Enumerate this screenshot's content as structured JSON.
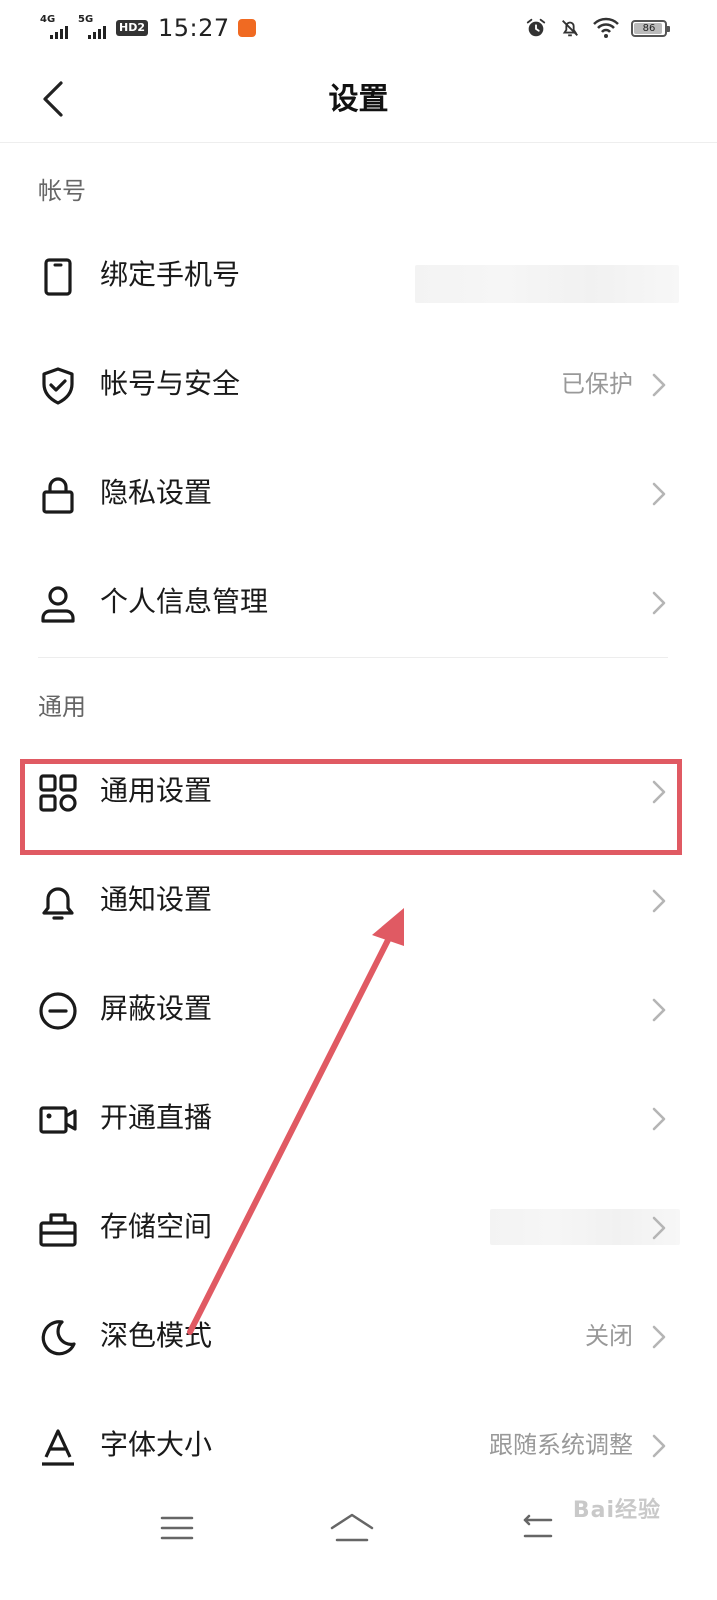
{
  "status_bar": {
    "net1": "4G",
    "net2": "5G",
    "hd": "HD2",
    "time": "15:27",
    "battery": "86",
    "battery_level": 0.86,
    "icons": [
      "alarm-icon",
      "mute-icon",
      "wifi-icon",
      "battery-icon"
    ]
  },
  "header": {
    "title": "设置",
    "back_icon": "chevron-left-icon"
  },
  "sections": {
    "account": {
      "title": "帐号",
      "items": [
        {
          "label": "绑定手机号",
          "value": "",
          "icon": "phone-icon",
          "chevron": false
        },
        {
          "label": "帐号与安全",
          "value": "已保护",
          "icon": "shield-check-icon",
          "chevron": true
        },
        {
          "label": "隐私设置",
          "value": "",
          "icon": "lock-icon",
          "chevron": true
        },
        {
          "label": "个人信息管理",
          "value": "",
          "icon": "user-icon",
          "chevron": true
        }
      ]
    },
    "general": {
      "title": "通用",
      "items": [
        {
          "label": "通用设置",
          "value": "",
          "icon": "grid-icon",
          "chevron": true
        },
        {
          "label": "通知设置",
          "value": "",
          "icon": "bell-icon",
          "chevron": true
        },
        {
          "label": "屏蔽设置",
          "value": "",
          "icon": "block-icon",
          "chevron": true
        },
        {
          "label": "开通直播",
          "value": "",
          "icon": "video-icon",
          "chevron": true
        },
        {
          "label": "存储空间",
          "value": "",
          "icon": "storage-icon",
          "chevron": true
        },
        {
          "label": "深色模式",
          "value": "关闭",
          "icon": "moon-icon",
          "chevron": true
        },
        {
          "label": "字体大小",
          "value": "跟随系统调整",
          "icon": "font-icon",
          "chevron": true
        }
      ]
    }
  },
  "nav_bar": {
    "icons": [
      "menu-icon",
      "home-icon",
      "back-nav-icon"
    ]
  },
  "watermark": "Bai经验",
  "colors": {
    "highlight": "#e05a63",
    "text_primary": "#1a1a1a",
    "text_secondary": "#999999",
    "section_label": "#666666"
  }
}
